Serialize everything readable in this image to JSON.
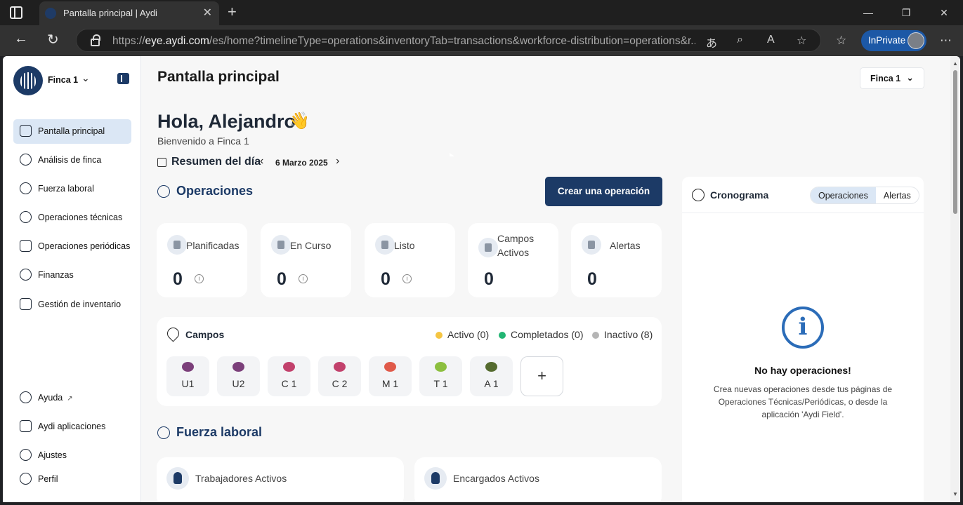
{
  "browser": {
    "tab_title": "Pantalla principal | Aydi",
    "url_prefix": "https://",
    "url_host": "eye.aydi.com",
    "url_rest": "/es/home?timelineType=operations&inventoryTab=transactions&workforce-distribution=operations&r...",
    "inprivate_label": "InPrivate"
  },
  "sidebar": {
    "farm_name": "Finca 1",
    "items": [
      {
        "label": "Pantalla principal",
        "icon": "home-icon",
        "active": true
      },
      {
        "label": "Análisis de finca",
        "icon": "pie-chart-icon"
      },
      {
        "label": "Fuerza laboral",
        "icon": "people-icon"
      },
      {
        "label": "Operaciones técnicas",
        "icon": "tractor-icon"
      },
      {
        "label": "Operaciones periódicas",
        "icon": "periodic-icon"
      },
      {
        "label": "Finanzas",
        "icon": "dollar-icon"
      },
      {
        "label": "Gestión de inventario",
        "icon": "warehouse-icon"
      }
    ],
    "bottom_items": [
      {
        "label": "Ayuda",
        "icon": "help-icon"
      },
      {
        "label": "Aydi aplicaciones",
        "icon": "phone-icon"
      },
      {
        "label": "Ajustes",
        "icon": "gear-icon"
      },
      {
        "label": "Perfil",
        "icon": "user-icon"
      }
    ]
  },
  "header": {
    "title": "Pantalla principal",
    "farm_select": "Finca 1"
  },
  "greeting": {
    "title": "Hola, Alejandro",
    "emoji": "👋",
    "subtitle": "Bienvenido a Finca 1"
  },
  "summary": {
    "label": "Resumen del día",
    "date": "6 Marzo 2025"
  },
  "operations": {
    "title": "Operaciones",
    "create_button": "Crear una operación",
    "stats": [
      {
        "label": "Planificadas",
        "value": "0",
        "info": true
      },
      {
        "label": "En Curso",
        "value": "0",
        "info": true
      },
      {
        "label": "Listo",
        "value": "0",
        "info": true
      },
      {
        "label": "Campos Activos",
        "value": "0",
        "info": false
      },
      {
        "label": "Alertas",
        "value": "0",
        "info": false
      }
    ]
  },
  "campos": {
    "title": "Campos",
    "legend": [
      {
        "label": "Activo (0)",
        "color": "#f5c542"
      },
      {
        "label": "Completados (0)",
        "color": "#22b573"
      },
      {
        "label": "Inactivo (8)",
        "color": "#b5b5b5"
      }
    ],
    "fields": [
      {
        "name": "U1",
        "color": "#7b3f7a"
      },
      {
        "name": "U2",
        "color": "#7b3f7a"
      },
      {
        "name": "C 1",
        "color": "#c2416c"
      },
      {
        "name": "C 2",
        "color": "#c2416c"
      },
      {
        "name": "M 1",
        "color": "#e05a4a"
      },
      {
        "name": "T 1",
        "color": "#8cbf3f"
      },
      {
        "name": "A 1",
        "color": "#556b2f"
      }
    ],
    "add_label": "+"
  },
  "workforce": {
    "title": "Fuerza laboral",
    "cards": [
      {
        "label": "Trabajadores Activos"
      },
      {
        "label": "Encargados Activos"
      }
    ]
  },
  "timeline": {
    "title": "Cronograma",
    "tabs": [
      "Operaciones",
      "Alertas"
    ],
    "empty_icon": "i",
    "empty_title": "No hay operaciones!",
    "empty_desc": "Crea nuevas operaciones desde tus páginas de Operaciones Técnicas/Periódicas, o desde la aplicación 'Aydi Field'."
  }
}
